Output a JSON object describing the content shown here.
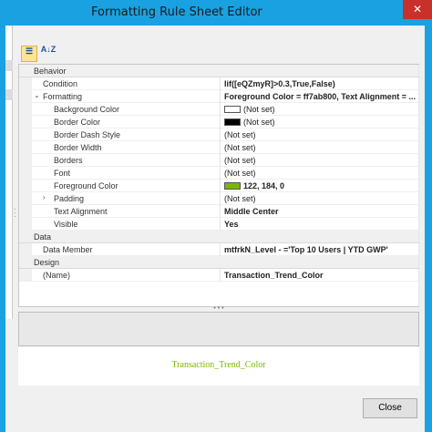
{
  "window": {
    "title": "Formatting Rule Sheet Editor",
    "close_glyph": "✕"
  },
  "toolbar": {
    "categorized_label": "☰",
    "alphabetical_label": "A↓Z"
  },
  "grid": {
    "categories": [
      {
        "name": "Behavior"
      },
      {
        "name": "Data"
      },
      {
        "name": "Design"
      }
    ],
    "rows": {
      "condition": {
        "name": "Condition",
        "value": "Iif([eQZmyR]>0.3,True,False)"
      },
      "formatting": {
        "name": "Formatting",
        "value": "Foreground Color = ff7ab800, Text Alignment = ..."
      },
      "background_color": {
        "name": "Background Color",
        "value": "(Not set)",
        "swatch": "#ffffff"
      },
      "border_color": {
        "name": "Border Color",
        "value": "(Not set)",
        "swatch": "#000000"
      },
      "border_dash_style": {
        "name": "Border Dash Style",
        "value": "(Not set)"
      },
      "border_width": {
        "name": "Border Width",
        "value": "(Not set)"
      },
      "borders": {
        "name": "Borders",
        "value": "(Not set)"
      },
      "font": {
        "name": "Font",
        "value": "(Not set)"
      },
      "foreground_color": {
        "name": "Foreground Color",
        "value": "122, 184, 0",
        "swatch": "#7ab800"
      },
      "padding": {
        "name": "Padding",
        "value": "(Not set)"
      },
      "text_alignment": {
        "name": "Text Alignment",
        "value": "Middle Center"
      },
      "visible": {
        "name": "Visible",
        "value": "Yes"
      },
      "data_member": {
        "name": "Data Member",
        "value": "mtfrkN_Level - ='Top 10 Users | YTD GWP'"
      },
      "name": {
        "name": "(Name)",
        "value": "Transaction_Trend_Color"
      }
    }
  },
  "preview": {
    "text": "Transaction_Trend_Color",
    "color": "#7ab800"
  },
  "footer": {
    "close_label": "Close"
  },
  "colors": {
    "accent": "#1aa1e2",
    "close_red": "#c8302a"
  }
}
